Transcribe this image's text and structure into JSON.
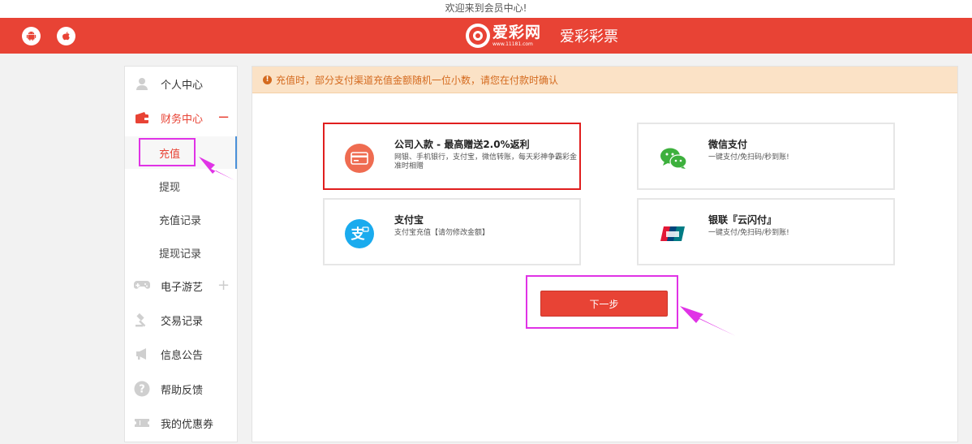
{
  "top": {
    "welcome": "欢迎来到会员中心!"
  },
  "header": {
    "android_icon": "android-icon",
    "apple_icon": "apple-icon",
    "logo_text": "爱彩网",
    "logo_sub": "www.11181.com",
    "brand": "爱彩彩票",
    "color": "#e84335"
  },
  "sidebar": {
    "items": [
      {
        "label": "个人中心",
        "icon": "user-icon"
      },
      {
        "label": "财务中心",
        "icon": "wallet-icon",
        "control": "−"
      },
      {
        "label": "电子游艺",
        "icon": "gamepad-icon",
        "control": "+"
      },
      {
        "label": "交易记录",
        "icon": "gavel-icon"
      },
      {
        "label": "信息公告",
        "icon": "megaphone-icon"
      },
      {
        "label": "帮助反馈",
        "icon": "help-icon"
      },
      {
        "label": "我的优惠券",
        "icon": "coupon-icon"
      }
    ],
    "finance_sub": [
      "充值",
      "提现",
      "充值记录",
      "提现记录"
    ]
  },
  "main": {
    "notice": "充值时，部分支付渠道充值金额随机一位小数，请您在付款时确认",
    "methods": [
      {
        "title": "公司入款 - 最高赠送2.0%返利",
        "desc": "网银、手机银行，支付宝，微信转账，每天彩神争霸彩金准时相赠",
        "icon": "card-icon",
        "selected": true
      },
      {
        "title": "微信支付",
        "desc": "一键支付/免扫码/秒到账!",
        "icon": "wechat-icon",
        "selected": false
      },
      {
        "title": "支付宝",
        "desc": "支付宝充值【请勿修改金额】",
        "icon": "alipay-icon",
        "selected": false
      },
      {
        "title": "银联『云闪付』",
        "desc": "一键支付/免扫码/秒到账!",
        "icon": "unionpay-icon",
        "selected": false
      }
    ],
    "next_button": "下一步"
  },
  "colors": {
    "accent": "#e84335",
    "annotation": "#e033e6",
    "notice_bg": "#fbe2c6",
    "notice_text": "#d46a1e"
  }
}
